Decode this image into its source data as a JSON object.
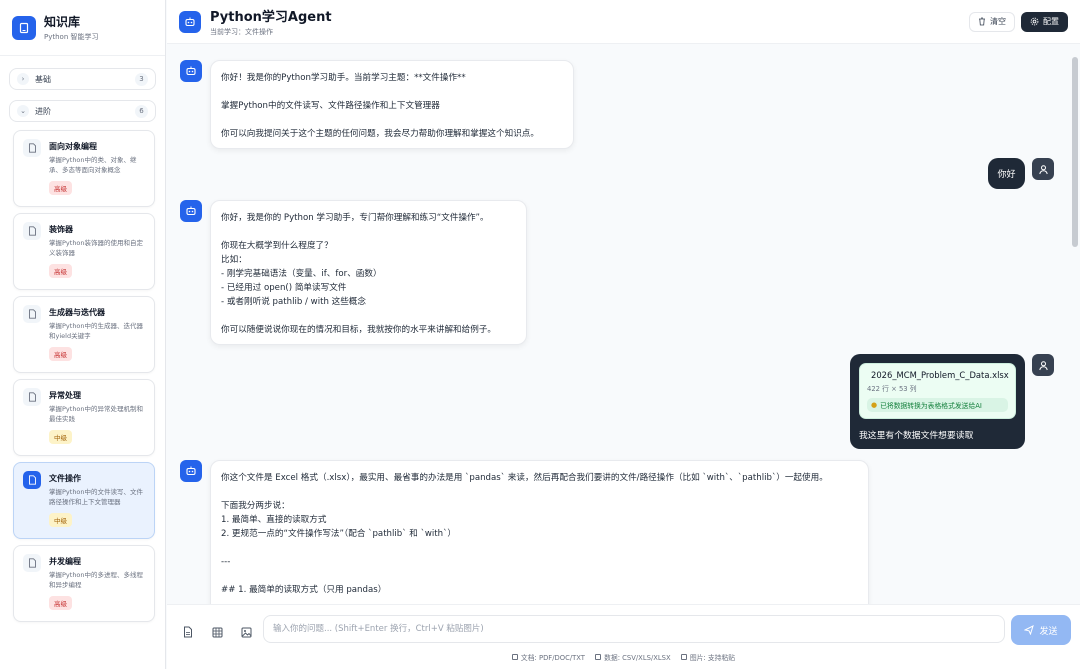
{
  "sidebar": {
    "title": "知识库",
    "subtitle": "Python 智能学习",
    "groups": [
      {
        "label": "基础",
        "count": "3",
        "chevron": "›"
      },
      {
        "label": "进阶",
        "count": "6",
        "chevron": "⌄"
      }
    ],
    "topics": [
      {
        "title": "面向对象编程",
        "desc": "掌握Python中的类、对象、继承、多态等面向对象概念",
        "level": "高级"
      },
      {
        "title": "装饰器",
        "desc": "掌握Python装饰器的使用和自定义装饰器",
        "level": "高级"
      },
      {
        "title": "生成器与迭代器",
        "desc": "掌握Python中的生成器、迭代器和yield关键字",
        "level": "高级"
      },
      {
        "title": "异常处理",
        "desc": "掌握Python中的异常处理机制和最佳实践",
        "level": "中级"
      },
      {
        "title": "文件操作",
        "desc": "掌握Python中的文件读写、文件路径操作和上下文管理器",
        "level": "中级"
      },
      {
        "title": "并发编程",
        "desc": "掌握Python中的多进程、多线程和异步编程",
        "level": "高级"
      }
    ]
  },
  "header": {
    "title": "Python学习Agent",
    "subtitle": "当前学习：文件操作",
    "clear_label": "清空",
    "config_label": "配置"
  },
  "messages": {
    "m1": "你好！我是你的Python学习助手。当前学习主题：**文件操作**\n\n掌握Python中的文件读写、文件路径操作和上下文管理器\n\n你可以向我提问关于这个主题的任何问题，我会尽力帮助你理解和掌握这个知识点。",
    "m2": "你好",
    "m3": "你好，我是你的 Python 学习助手，专门帮你理解和练习“文件操作”。\n\n你现在大概学到什么程度了？\n比如：\n- 刚学完基础语法（变量、if、for、函数）\n- 已经用过 open() 简单读写文件\n- 或者刚听说 pathlib / with 这些概念\n\n你可以随便说说你现在的情况和目标，我就按你的水平来讲解和给例子。",
    "m4": {
      "file_name": "2026_MCM_Problem_C_Data.xlsx",
      "file_meta": "422 行 × 53 列",
      "file_hint": "已将数据转换为表格格式发送给AI",
      "text": "我这里有个数据文件想要读取"
    },
    "m5": "你这个文件是 Excel 格式（.xlsx），最实用、最省事的办法是用 `pandas` 来读，然后再配合我们要讲的文件/路径操作（比如 `with`、`pathlib`）一起使用。\n\n下面我分两步说：\n1. 最简单、直接的读取方式\n2. 更规范一点的“文件操作写法”（配合 `pathlib` 和 `with`）\n\n---\n\n## 1. 最简单的读取方式（只用 pandas）"
  },
  "composer": {
    "placeholder": "输入你的问题... (Shift+Enter 换行，Ctrl+V 粘贴图片)",
    "send_label": "发送",
    "hint_docs": "文档: PDF/DOC/TXT",
    "hint_data": "数据: CSV/XLS/XLSX",
    "hint_image": "图片: 支持粘贴"
  },
  "colors": {
    "accent": "#2563eb",
    "dark": "#1f2937",
    "badge_advanced": "#c53030",
    "badge_intermediate": "#a16207"
  }
}
